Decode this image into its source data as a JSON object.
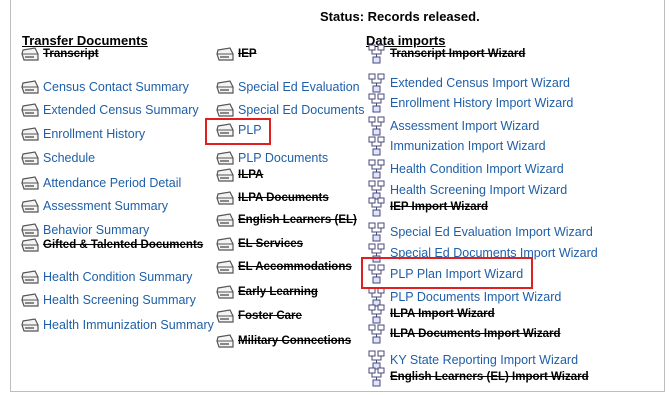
{
  "status": "Status: Records released.",
  "colors": {
    "link": "#1f5fa8",
    "highlight": "#e02020"
  },
  "transfer": {
    "heading": "Transfer Documents",
    "items": [
      {
        "label": "Transcript",
        "disabled": true
      },
      {
        "label": "Census Contact Summary",
        "disabled": false
      },
      {
        "label": "Extended Census Summary",
        "disabled": false
      },
      {
        "label": "Enrollment History",
        "disabled": false
      },
      {
        "label": "Schedule",
        "disabled": false
      },
      {
        "label": "Attendance Period Detail",
        "disabled": false
      },
      {
        "label": "Assessment Summary",
        "disabled": false
      },
      {
        "label": "Behavior Summary",
        "disabled": false
      },
      {
        "label": "Gifted & Talented Documents",
        "disabled": true
      },
      {
        "label": "Health Condition Summary",
        "disabled": false
      },
      {
        "label": "Health Screening Summary",
        "disabled": false
      },
      {
        "label": "Health Immunization Summary",
        "disabled": false
      }
    ]
  },
  "middle": {
    "items": [
      {
        "label": "IEP",
        "disabled": true
      },
      {
        "label": "Special Ed Evaluation",
        "disabled": false
      },
      {
        "label": "Special Ed Documents",
        "disabled": false
      },
      {
        "label": "PLP",
        "disabled": false
      },
      {
        "label": "PLP Documents",
        "disabled": false
      },
      {
        "label": "ILPA",
        "disabled": true
      },
      {
        "label": "ILPA Documents",
        "disabled": true
      },
      {
        "label": "English Learners (EL)",
        "disabled": true
      },
      {
        "label": "EL Services",
        "disabled": true
      },
      {
        "label": "EL Accommodations",
        "disabled": true
      },
      {
        "label": "Early Learning",
        "disabled": true
      },
      {
        "label": "Foster Care",
        "disabled": true
      },
      {
        "label": "Military Connections",
        "disabled": true
      }
    ]
  },
  "imports": {
    "heading": "Data imports",
    "items": [
      {
        "label": "Transcript Import Wizard",
        "disabled": true
      },
      {
        "label": "Extended Census Import Wizard",
        "disabled": false
      },
      {
        "label": "Enrollment History Import Wizard",
        "disabled": false
      },
      {
        "label": "Assessment Import Wizard",
        "disabled": false
      },
      {
        "label": "Immunization Import Wizard",
        "disabled": false
      },
      {
        "label": "Health Condition Import Wizard",
        "disabled": false
      },
      {
        "label": "Health Screening Import Wizard",
        "disabled": false
      },
      {
        "label": "IEP Import Wizard",
        "disabled": true
      },
      {
        "label": "Special Ed Evaluation Import Wizard",
        "disabled": false
      },
      {
        "label": "Special Ed Documents Import Wizard",
        "disabled": false
      },
      {
        "label": "PLP Plan Import Wizard",
        "disabled": false
      },
      {
        "label": "PLP Documents Import Wizard",
        "disabled": false
      },
      {
        "label": "ILPA Import Wizard",
        "disabled": true
      },
      {
        "label": "ILPA Documents Import Wizard",
        "disabled": true
      },
      {
        "label": "KY State Reporting Import Wizard",
        "disabled": false
      },
      {
        "label": "English Learners (EL) Import Wizard",
        "disabled": true
      }
    ]
  }
}
